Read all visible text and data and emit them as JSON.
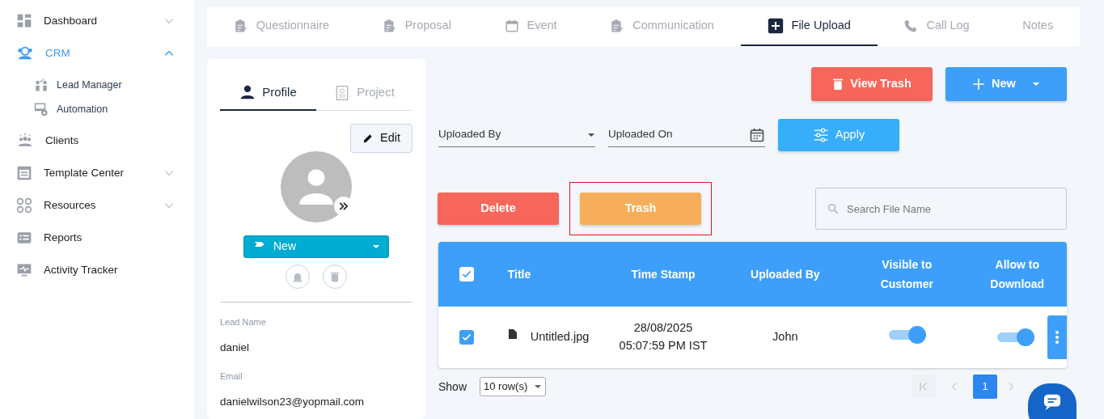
{
  "sidebar": {
    "items": [
      {
        "label": "Dashboard",
        "selected": false,
        "expandable": true,
        "expanded": false
      },
      {
        "label": "CRM",
        "selected": true,
        "expandable": true,
        "expanded": true,
        "children": [
          {
            "label": "Lead Manager"
          },
          {
            "label": "Automation"
          }
        ]
      },
      {
        "label": "Clients",
        "selected": false,
        "expandable": false,
        "expanded": false
      },
      {
        "label": "Template Center",
        "selected": false,
        "expandable": true,
        "expanded": false
      },
      {
        "label": "Resources",
        "selected": false,
        "expandable": true,
        "expanded": false
      },
      {
        "label": "Reports",
        "selected": false,
        "expandable": false,
        "expanded": false
      },
      {
        "label": "Activity Tracker",
        "selected": false,
        "expandable": false,
        "expanded": false
      }
    ]
  },
  "tabs": [
    {
      "label": "Questionnaire",
      "selected": false
    },
    {
      "label": "Proposal",
      "selected": false
    },
    {
      "label": "Event",
      "selected": false
    },
    {
      "label": "Communication",
      "selected": false
    },
    {
      "label": "File Upload",
      "selected": true
    },
    {
      "label": "Call Log",
      "selected": false
    },
    {
      "label": "Notes",
      "selected": false
    }
  ],
  "profile": {
    "tabs": [
      {
        "label": "Profile",
        "selected": true
      },
      {
        "label": "Project",
        "selected": false
      }
    ],
    "edit_button": "Edit",
    "status": "New",
    "fields": [
      {
        "label": "Lead Name",
        "value": "daniel"
      },
      {
        "label": "Email",
        "value": "danielwilson23@yopmail.com"
      }
    ]
  },
  "actions": {
    "view_trash": "View Trash",
    "new": "New"
  },
  "filters": {
    "uploaded_by": "Uploaded By",
    "uploaded_on": "Uploaded On",
    "apply": "Apply"
  },
  "bulk": [
    {
      "label": "Delete",
      "highlighted": false
    },
    {
      "label": "Trash",
      "highlighted": true
    }
  ],
  "search": {
    "placeholder": "Search File Name"
  },
  "table": {
    "all_checked": true,
    "columns": [
      "Title",
      "Time Stamp",
      "Uploaded By",
      "Visible to Customer",
      "Allow to Download"
    ],
    "rows": [
      {
        "checked": true,
        "title": "Untitled.jpg",
        "date": "28/08/2025",
        "time": "05:07:59 PM IST",
        "uploaded_by": "John",
        "visible": true,
        "download": true
      }
    ]
  },
  "footer": {
    "show_label": "Show",
    "rows_per_page": "10 row(s)",
    "pages": [
      {
        "label": "1",
        "selected": true
      }
    ]
  }
}
